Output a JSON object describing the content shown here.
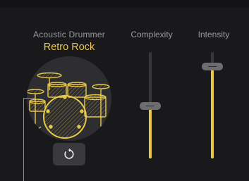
{
  "drummer": {
    "title": "Acoustic Drummer",
    "preset": "Retro Rock",
    "accent_color": "#e8c94a"
  },
  "controls": {
    "complexity_label": "Complexity",
    "intensity_label": "Intensity",
    "complexity_value": 0.49,
    "intensity_value": 0.86
  },
  "icons": {
    "refresh": "refresh-icon",
    "drum_kit": "drum-kit-icon"
  }
}
